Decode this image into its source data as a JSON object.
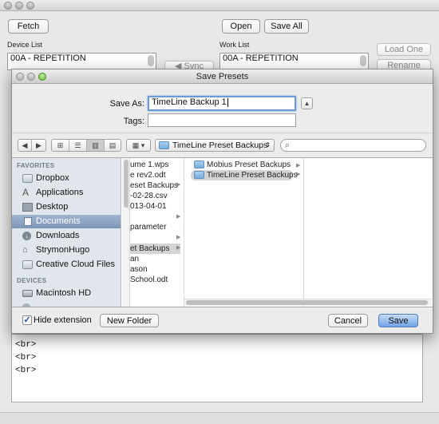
{
  "main_window": {
    "fetch_label": "Fetch",
    "open_label": "Open",
    "save_all_label": "Save All",
    "device_list_label": "Device List",
    "work_list_label": "Work List",
    "device_list_items": [
      "00A - REPETITION"
    ],
    "work_list_items": [
      "00A - REPETITION"
    ],
    "sync_label": "Sync",
    "load_one_label": "Load One",
    "rename_label": "Rename",
    "text_lines": [
      "<br>",
      "<br>",
      "<br>"
    ]
  },
  "dialog": {
    "title": "Save Presets",
    "save_as_label": "Save As:",
    "save_as_value": "TimeLine Backup 1",
    "tags_label": "Tags:",
    "tags_value": "",
    "location": "TimeLine Preset Backups",
    "sidebar": {
      "favorites_header": "FAVORITES",
      "favorites": [
        {
          "label": "Dropbox",
          "icon": "folder-icon"
        },
        {
          "label": "Applications",
          "icon": "applications-icon"
        },
        {
          "label": "Desktop",
          "icon": "desktop-icon"
        },
        {
          "label": "Documents",
          "icon": "documents-icon"
        },
        {
          "label": "Downloads",
          "icon": "downloads-icon"
        },
        {
          "label": "StrymonHugo",
          "icon": "home-icon"
        },
        {
          "label": "Creative Cloud Files",
          "icon": "folder-icon"
        }
      ],
      "devices_header": "DEVICES",
      "devices": [
        {
          "label": "Macintosh HD",
          "icon": "disk-icon"
        }
      ]
    },
    "column1": [
      "ume 1.wps",
      "e rev2.odt",
      "eset Backups",
      "-02-28.csv",
      "013-04-01",
      "",
      "parameter",
      "",
      "et Backups",
      "an",
      "ason",
      "School.odt"
    ],
    "column2": [
      "Mobius Preset Backups",
      "TimeLine Preset Backups"
    ],
    "hide_extension_label": "Hide extension",
    "hide_extension_checked": true,
    "new_folder_label": "New Folder",
    "cancel_label": "Cancel",
    "save_label": "Save"
  }
}
